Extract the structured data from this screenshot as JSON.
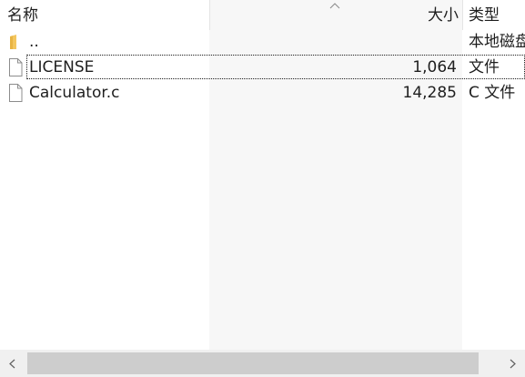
{
  "columns": {
    "name": "名称",
    "size": "大小",
    "type": "类型"
  },
  "sort": {
    "column": "size",
    "icon": "sort-up-arrow-icon"
  },
  "rows": [
    {
      "icon": "folder-icon",
      "name": "..",
      "size": "",
      "type": "本地磁盘"
    },
    {
      "icon": "file-icon",
      "name": "LICENSE",
      "size": "1,064",
      "type": "文件"
    },
    {
      "icon": "file-icon",
      "name": "Calculator.c",
      "size": "14,285",
      "type": "C 文件"
    }
  ],
  "focused_row": 1,
  "scrollbar": {
    "orientation": "horizontal",
    "left_icon": "scroll-left-arrow-icon",
    "right_icon": "scroll-right-arrow-icon"
  },
  "colors": {
    "header_bg": "#ffffff",
    "size_column_bg": "#f7f7f7",
    "text": "#1e1e1e",
    "folder": "#f3c65f",
    "scroll_thumb": "#cdcdcd",
    "scroll_track": "#f0f0f0"
  }
}
